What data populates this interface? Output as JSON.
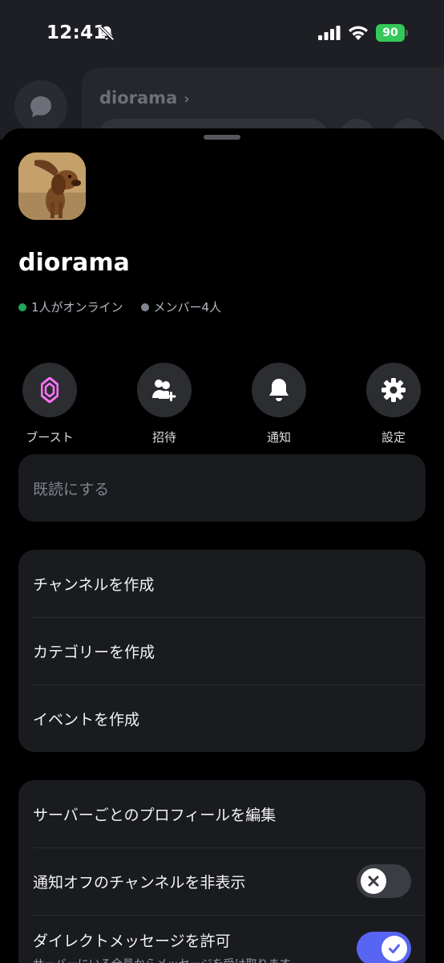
{
  "status": {
    "time": "12:41",
    "battery": "90"
  },
  "background": {
    "server_name": "diorama",
    "chevron": "›"
  },
  "sheet": {
    "server_name": "diorama",
    "online": "1人がオンライン",
    "members": "メンバー4人",
    "actions": [
      {
        "label": "ブースト",
        "icon": "boost-icon"
      },
      {
        "label": "招待",
        "icon": "invite-icon"
      },
      {
        "label": "通知",
        "icon": "bell-icon"
      },
      {
        "label": "設定",
        "icon": "gear-icon"
      }
    ],
    "mark_read": "既読にする",
    "create": {
      "channel": "チャンネルを作成",
      "category": "カテゴリーを作成",
      "event": "イベントを作成"
    },
    "settings": {
      "edit_profile": "サーバーごとのプロフィールを編集",
      "hide_muted": "通知オフのチャンネルを非表示",
      "allow_dm": "ダイレクトメッセージを許可",
      "allow_dm_sub": "サーバーにいる全員からメッセージを受け取ります。"
    }
  },
  "colors": {
    "accent": "#5865f2",
    "online": "#23a55a",
    "boost": "#ff73fa"
  }
}
